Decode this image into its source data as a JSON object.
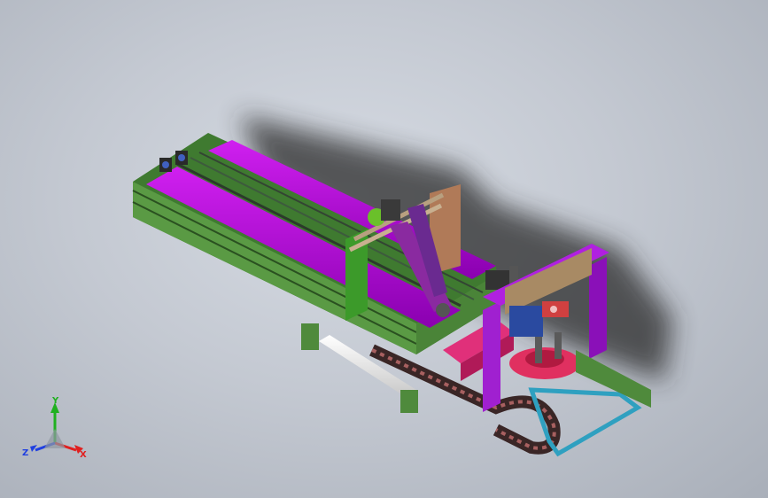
{
  "triad": {
    "x_label": "X",
    "y_label": "Y",
    "z_label": "Z",
    "colors": {
      "x": "#e02020",
      "y": "#20b020",
      "z": "#2040e0"
    }
  },
  "palette": {
    "frame_green": "#4f8a3c",
    "rail_magenta": "#c000e0",
    "carrier_pink": "#e0307a",
    "frame_violet": "#a020d0",
    "plate_tan": "#a88a64",
    "tube_white": "#f2f2f2",
    "chain_dark": "#3a2a2a",
    "base_cyan": "#2fa0c0"
  }
}
